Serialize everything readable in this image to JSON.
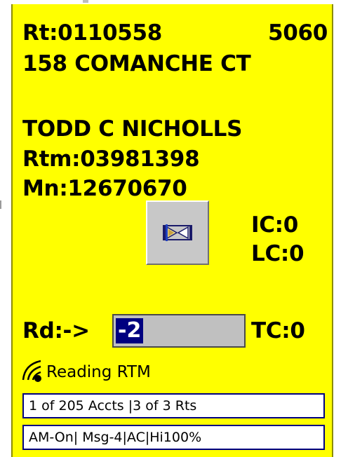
{
  "route": {
    "label": "Rt:0110558",
    "number": "5060"
  },
  "address": "158 COMANCHE CT",
  "customer": {
    "name": "TODD C NICHOLLS",
    "rtm": "Rtm:03981398",
    "mn": "Mn:12670670"
  },
  "counters": {
    "ic": "IC:0",
    "lc": "LC:0",
    "tc": "TC:0"
  },
  "reading": {
    "label": "Rd:->",
    "value": "-2"
  },
  "status": {
    "text": "Reading RTM",
    "icon": "signal-icon"
  },
  "hourglass_icon": "hourglass-icon",
  "footer": {
    "accounts": "1 of 205 Accts |3 of 3 Rts",
    "modes": "AM-On| Msg-4|AC|Hi100%"
  },
  "colors": {
    "screen_bg": "#ffff00",
    "selection": "#000080",
    "bar_border": "#000080",
    "input_bg": "#c0c0c0"
  }
}
